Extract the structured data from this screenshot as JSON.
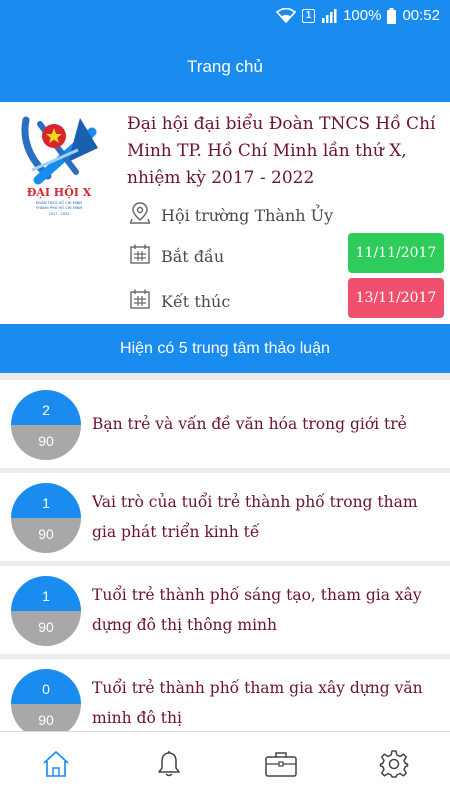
{
  "status_bar": {
    "sim_label": "1",
    "battery": "100%",
    "time": "00:52"
  },
  "header": {
    "title": "Trang chủ"
  },
  "event": {
    "logo_text": "ĐẠI HỘI X",
    "logo_subtext": "ĐOÀN TNCS HỒ CHÍ MINH THÀNH PHỐ HỒ CHÍ MINH",
    "title": "Đại hội đại biểu Đoàn TNCS Hồ Chí Minh TP. Hồ Chí Minh lần thứ X, nhiệm kỳ 2017 - 2022",
    "location": "Hội trường Thành Ủy",
    "start_label": "Bắt đầu",
    "start_date": "11/11/2017",
    "end_label": "Kết thúc",
    "end_date": "13/11/2017"
  },
  "colors": {
    "primary": "#1a8cf0",
    "start_badge": "#2ecc5a",
    "end_badge": "#f0506e",
    "title_text": "#6d1230"
  },
  "section": {
    "title": "Hiện có 5 trung tâm thảo luận"
  },
  "topics": [
    {
      "top_count": "2",
      "bottom_count": "90",
      "title": "Bạn trẻ và vấn đề văn hóa trong giới trẻ"
    },
    {
      "top_count": "1",
      "bottom_count": "90",
      "title": "Vai trò của tuổi trẻ thành phố trong tham gia phát triển kinh tế"
    },
    {
      "top_count": "1",
      "bottom_count": "90",
      "title": "Tuổi trẻ thành phố sáng tạo, tham gia xây dựng đô thị thông minh"
    },
    {
      "top_count": "0",
      "bottom_count": "90",
      "title": "Tuổi trẻ thành phố tham gia xây dựng văn minh đô thị"
    }
  ],
  "bottom_nav": [
    {
      "icon": "home-icon",
      "active": true
    },
    {
      "icon": "bell-icon",
      "active": false
    },
    {
      "icon": "briefcase-icon",
      "active": false
    },
    {
      "icon": "gear-icon",
      "active": false
    }
  ]
}
